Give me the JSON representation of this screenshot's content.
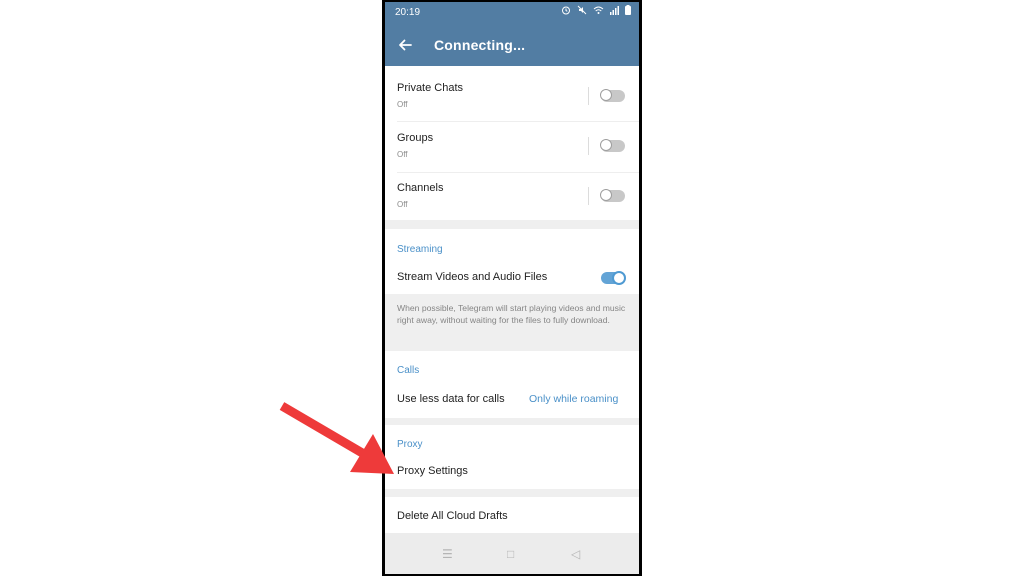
{
  "status_bar": {
    "time": "20:19",
    "icons": [
      "alarm-icon",
      "mute-icon",
      "wifi-icon",
      "signal-icon",
      "battery-icon"
    ]
  },
  "app_bar": {
    "title": "Connecting...",
    "back_icon": "arrow-left-icon"
  },
  "auto_download": {
    "items": [
      {
        "label": "Private Chats",
        "status": "Off",
        "enabled": false
      },
      {
        "label": "Groups",
        "status": "Off",
        "enabled": false
      },
      {
        "label": "Channels",
        "status": "Off",
        "enabled": false
      }
    ]
  },
  "streaming": {
    "header": "Streaming",
    "item_label": "Stream Videos and Audio Files",
    "enabled": true,
    "info": "When possible, Telegram will start playing videos and music right away, without waiting for the files to fully download."
  },
  "calls": {
    "header": "Calls",
    "item_label": "Use less data for calls",
    "item_value": "Only while roaming"
  },
  "proxy": {
    "header": "Proxy",
    "item_label": "Proxy Settings"
  },
  "drafts": {
    "item_label": "Delete All Cloud Drafts"
  },
  "nav_bar": {
    "menu_glyph": "☰",
    "home_glyph": "□",
    "back_glyph": "◁"
  },
  "colors": {
    "header_bar": "#527da3",
    "accent": "#4a90c8",
    "annotation_arrow": "#ee3a3a"
  }
}
